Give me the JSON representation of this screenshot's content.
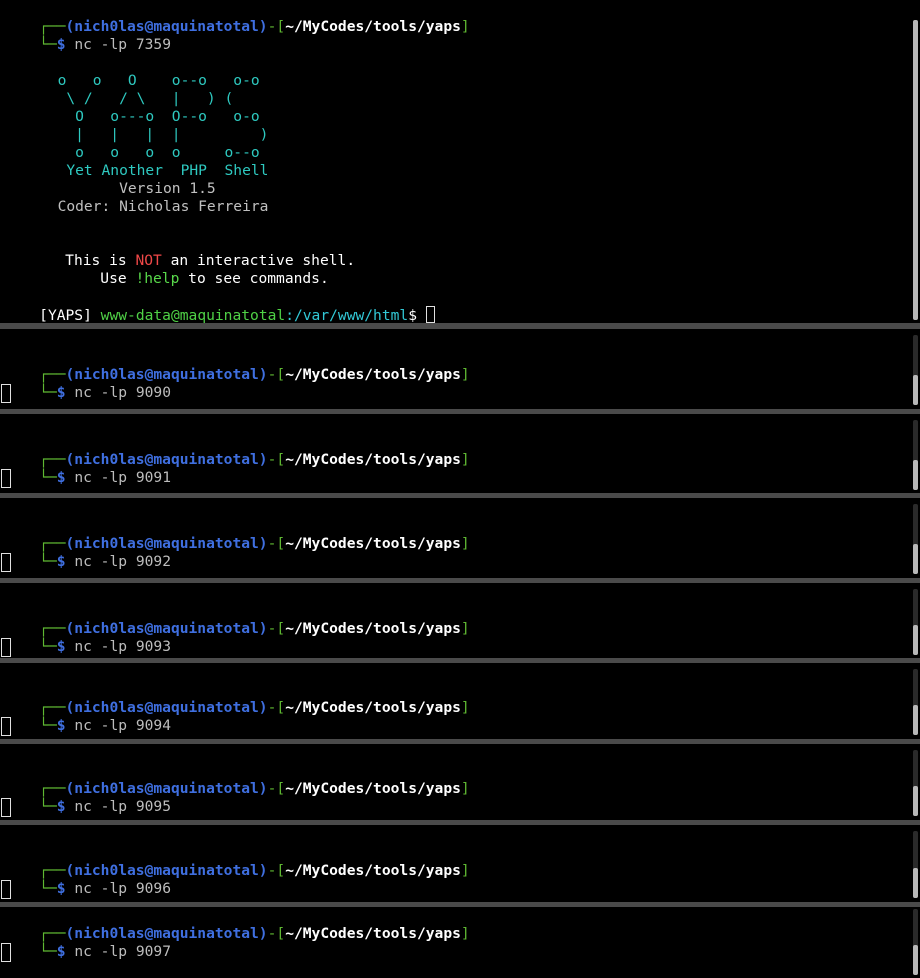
{
  "prompt": {
    "corner_top": "┌──",
    "corner_bottom": "└─",
    "user": "(nich0las@maquinatotal)",
    "sep": "-[",
    "path": "~/MyCodes/tools/yaps",
    "close": "]",
    "dollar": "$"
  },
  "panes": [
    {
      "command": "nc -lp 7359",
      "banner": {
        "art": [
          "  o   o   O    o--o   o-o ",
          "   \\ /   / \\   |   ) (    ",
          "    O   o---o  O--o   o-o ",
          "    |   |   |  |         )",
          "    o   o   o  o     o--o "
        ],
        "title": "   Yet Another  PHP  Shell",
        "version": "         Version 1.5",
        "coder": "  Coder: Nicholas Ferreira",
        "notice_pre": "This is ",
        "notice_not": "NOT",
        "notice_post": " an interactive shell.",
        "help_pre": "    Use ",
        "help_cmd": "!help",
        "help_post": " to see commands."
      },
      "yaps_prompt": {
        "tag": "[YAPS]",
        "user": "www-data@maquinatotal",
        "path": ":/var/www/html",
        "dollar": "$"
      }
    },
    {
      "command": "nc -lp 9090"
    },
    {
      "command": "nc -lp 9091"
    },
    {
      "command": "nc -lp 9092"
    },
    {
      "command": "nc -lp 9093"
    },
    {
      "command": "nc -lp 9094"
    },
    {
      "command": "nc -lp 9095"
    },
    {
      "command": "nc -lp 9096"
    },
    {
      "command": "nc -lp 9097"
    }
  ]
}
